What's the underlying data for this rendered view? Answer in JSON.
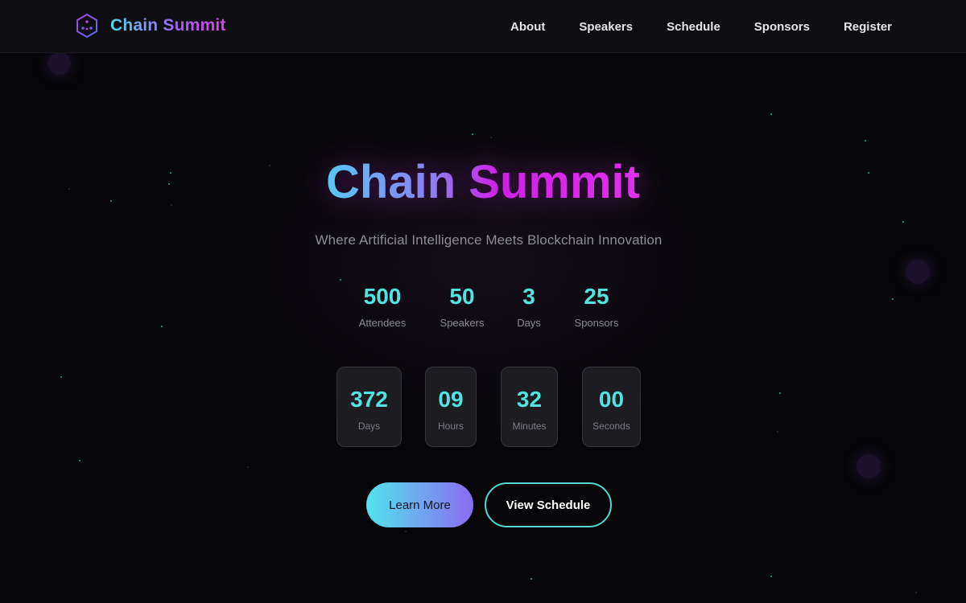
{
  "brand": {
    "name": "Chain Summit",
    "icon": "hexagon-network-icon"
  },
  "nav": {
    "items": [
      "About",
      "Speakers",
      "Schedule",
      "Sponsors",
      "Register"
    ]
  },
  "hero": {
    "title": "Chain Summit",
    "subtitle": "Where Artificial Intelligence Meets Blockchain Innovation"
  },
  "stats": [
    {
      "value": "500",
      "label": "Attendees"
    },
    {
      "value": "50",
      "label": "Speakers"
    },
    {
      "value": "3",
      "label": "Days"
    },
    {
      "value": "25",
      "label": "Sponsors"
    }
  ],
  "countdown": [
    {
      "value": "372",
      "label": "Days"
    },
    {
      "value": "09",
      "label": "Hours"
    },
    {
      "value": "32",
      "label": "Minutes"
    },
    {
      "value": "00",
      "label": "Seconds"
    }
  ],
  "buttons": {
    "primary": "Learn More",
    "secondary": "View Schedule"
  },
  "colors": {
    "accent_cyan": "#52e3e0",
    "accent_magenta": "#e040ea",
    "background": "#060608"
  }
}
